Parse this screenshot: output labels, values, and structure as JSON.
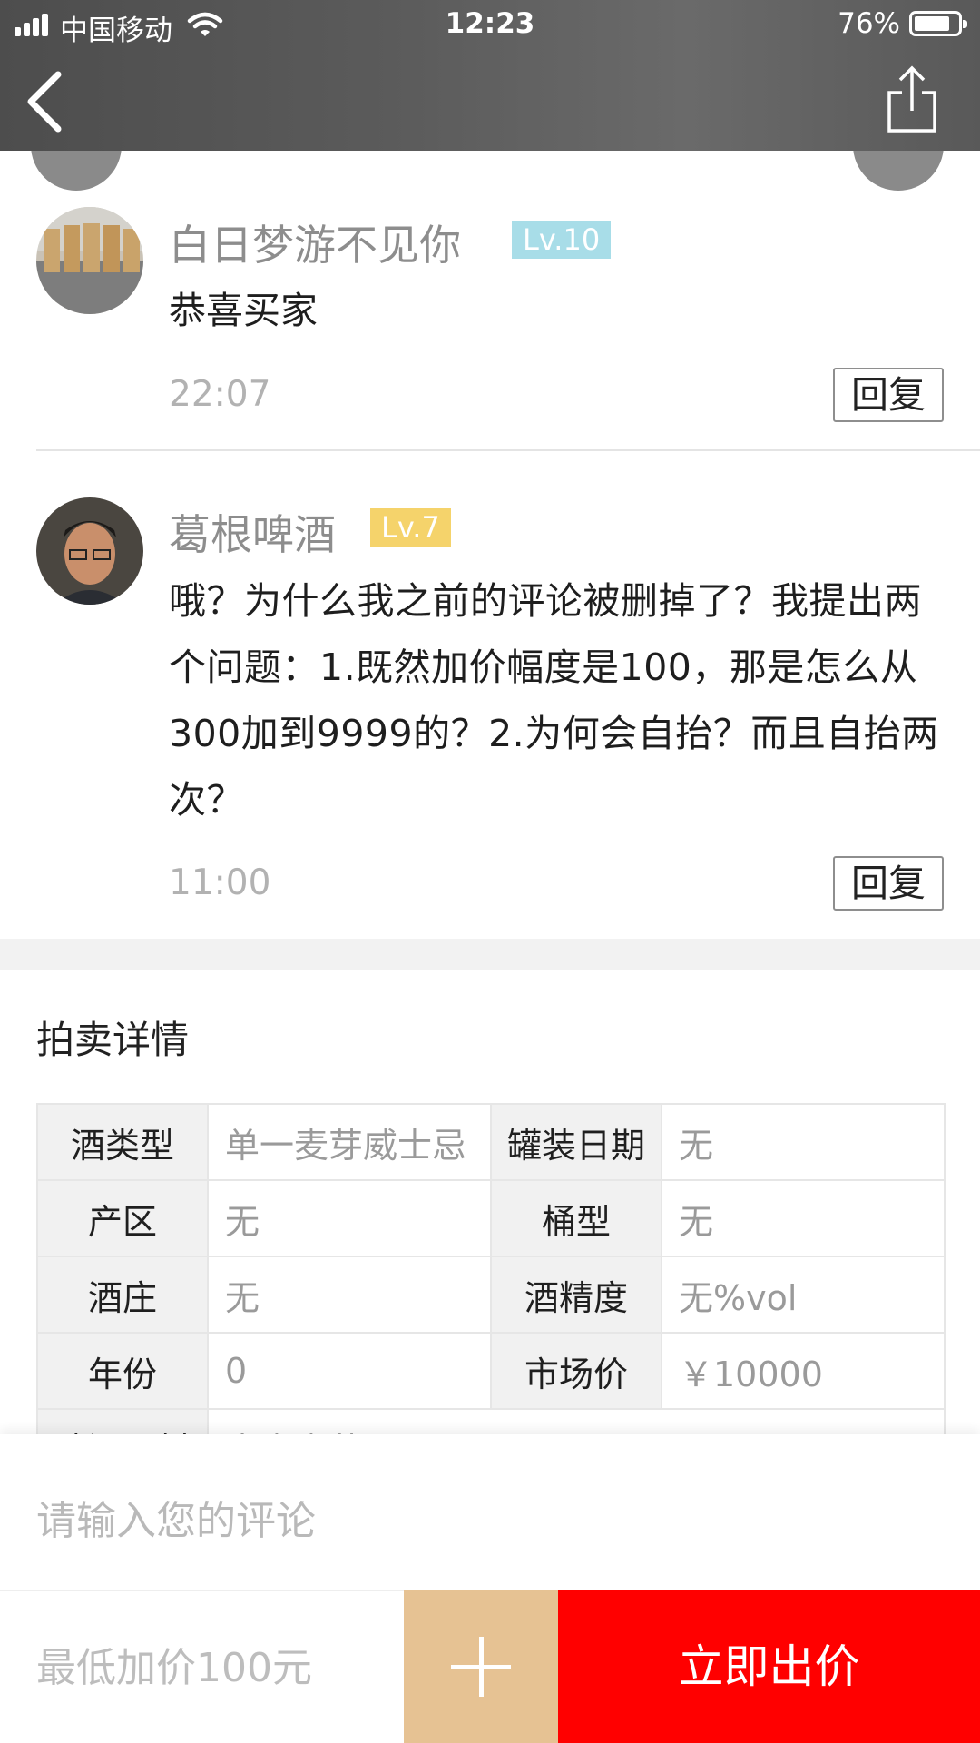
{
  "status_bar": {
    "carrier": "中国移动",
    "time": "12:23",
    "battery_percent": "76%",
    "battery_level": 0.76
  },
  "nav": {
    "back_icon": "chevron-left-icon",
    "share_icon": "share-icon"
  },
  "comments": [
    {
      "username": "白日梦游不见你",
      "level": "Lv.10",
      "level_color": "#a8dde8",
      "text": "恭喜买家",
      "time": "22:07",
      "reply_label": "回复"
    },
    {
      "username": "葛根啤酒",
      "level": "Lv.7",
      "level_color": "#f5d36b",
      "text": "哦？为什么我之前的评论被删掉了？我提出两个问题：1.既然加价幅度是100，那是怎么从300加到9999的？2.为何会自抬？而且自抬两次？",
      "time": "11:00",
      "reply_label": "回复"
    }
  ],
  "details": {
    "title": "拍卖详情",
    "rows": [
      [
        {
          "k": "酒类型",
          "v": "单一麦芽威士忌"
        },
        {
          "k": "罐装日期",
          "v": "无"
        }
      ],
      [
        {
          "k": "产区",
          "v": "无"
        },
        {
          "k": "桶型",
          "v": "无"
        }
      ],
      [
        {
          "k": "酒庄",
          "v": "无"
        },
        {
          "k": "酒精度",
          "v": "无%vol"
        }
      ],
      [
        {
          "k": "年份",
          "v": "0"
        },
        {
          "k": "市场价",
          "v": "￥10000"
        }
      ]
    ],
    "partial_row": {
      "k": "酿酒原料",
      "v": "大麦麦芽"
    }
  },
  "bottom_bar": {
    "comment_placeholder": "请输入您的评论",
    "bid_placeholder": "最低加价100元",
    "plus_icon": "plus-icon",
    "bid_button": "立即出价",
    "accent_color": "#ff0000",
    "plus_color": "#e6c293"
  }
}
